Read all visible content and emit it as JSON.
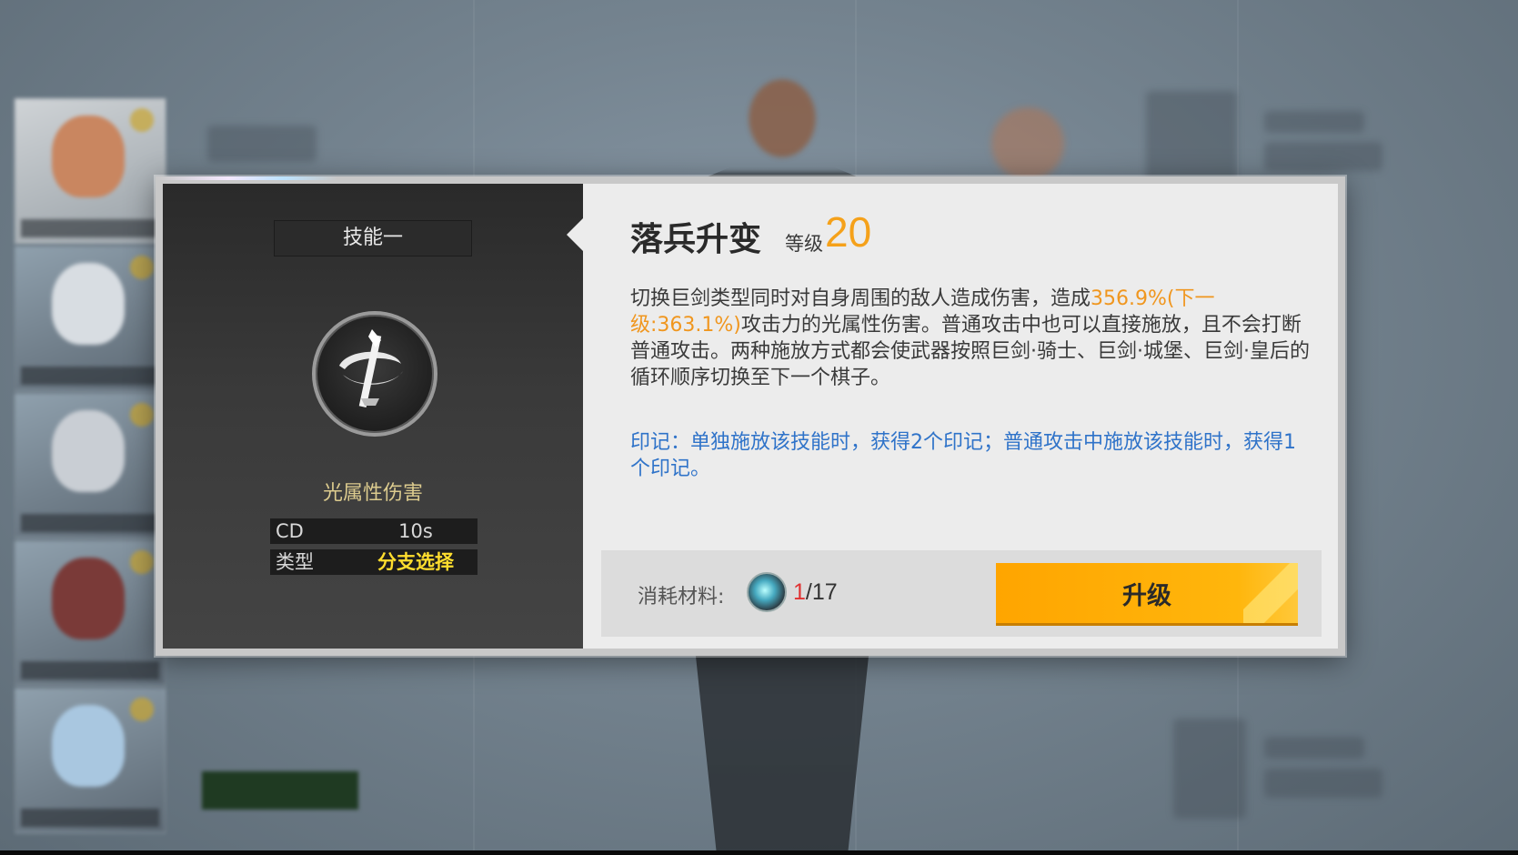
{
  "skill_panel": {
    "tab_label": "技能一",
    "damage_type": "光属性伤害",
    "stats": [
      {
        "key": "CD",
        "value": "10s"
      },
      {
        "key": "类型",
        "value": "分支选择"
      }
    ],
    "icon": "sword-spiral-icon"
  },
  "detail": {
    "skill_name": "落兵升变",
    "level_label": "等级",
    "level_value": "20",
    "description": {
      "part1": "切换巨剑类型同时对自身周围的敌人造成伤害，造成",
      "highlight": "356.9%(下一级:363.1%)",
      "part2": "攻击力的光属性伤害。普通攻击中也可以直接施放，且不会打断普通攻击。两种施放方式都会使武器按照巨剑·骑士、巨剑·城堡、巨剑·皇后的循环顺序切换至下一个棋子。"
    },
    "mark_text": "印记：单独施放该技能时，获得2个印记；普通攻击中施放该技能时，获得1个印记。"
  },
  "cost": {
    "label": "消耗材料:",
    "owned": "1",
    "required": "/17",
    "material_icon": "crystal-material-icon"
  },
  "upgrade_button": {
    "label": "升级"
  },
  "colors": {
    "accent_orange": "#f5a11a",
    "mark_blue": "#2f73c9",
    "type_yellow": "#ffde2e",
    "damage_gold": "#dccb8e"
  }
}
